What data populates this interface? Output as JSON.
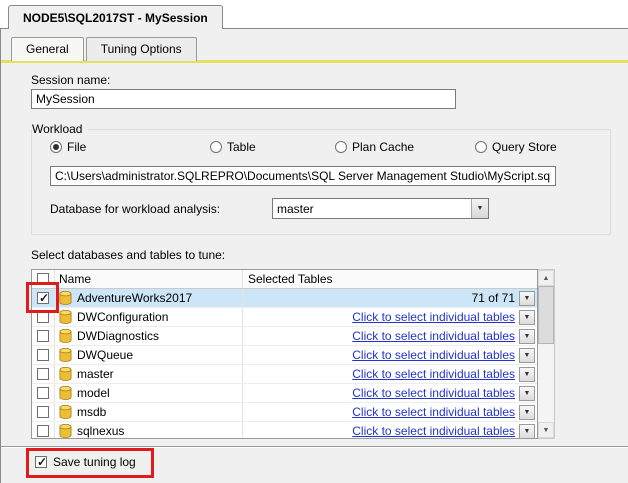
{
  "window": {
    "document_tab": "NODE5\\SQL2017ST - MySession"
  },
  "tabs": {
    "items": [
      {
        "label": "General"
      },
      {
        "label": "Tuning Options"
      }
    ],
    "active_index": 0
  },
  "session": {
    "label": "Session name:",
    "value": "MySession"
  },
  "workload": {
    "caption": "Workload",
    "options": [
      {
        "label": "File",
        "selected": true
      },
      {
        "label": "Table",
        "selected": false
      },
      {
        "label": "Plan Cache",
        "selected": false
      },
      {
        "label": "Query Store",
        "selected": false
      }
    ],
    "file_path": "C:\\Users\\administrator.SQLREPRO\\Documents\\SQL Server Management Studio\\MyScript.sql",
    "db_label": "Database for workload analysis:",
    "db_value": "master"
  },
  "tune": {
    "label": "Select databases and tables to tune:",
    "header": {
      "name": "Name",
      "selected_tables": "Selected Tables"
    },
    "rows": [
      {
        "name": "AdventureWorks2017",
        "checked": true,
        "value": "71 of 71",
        "is_link": false,
        "selected": true,
        "highlighted": true
      },
      {
        "name": "DWConfiguration",
        "checked": false,
        "value": "Click to select individual tables",
        "is_link": true
      },
      {
        "name": "DWDiagnostics",
        "checked": false,
        "value": "Click to select individual tables",
        "is_link": true
      },
      {
        "name": "DWQueue",
        "checked": false,
        "value": "Click to select individual tables",
        "is_link": true
      },
      {
        "name": "master",
        "checked": false,
        "value": "Click to select individual tables",
        "is_link": true
      },
      {
        "name": "model",
        "checked": false,
        "value": "Click to select individual tables",
        "is_link": true
      },
      {
        "name": "msdb",
        "checked": false,
        "value": "Click to select individual tables",
        "is_link": true
      },
      {
        "name": "sqlnexus",
        "checked": false,
        "value": "Click to select individual tables",
        "is_link": true
      }
    ]
  },
  "footer": {
    "save_label": "Save tuning log",
    "checked": true
  },
  "icons": {
    "dropdown": "▼",
    "scroll_up": "▲",
    "scroll_down": "▼"
  },
  "colors": {
    "accent_line": "#e3e15d",
    "selected_row": "#cde6f7",
    "link": "#2233cc",
    "highlight_red": "#e01b1b"
  }
}
